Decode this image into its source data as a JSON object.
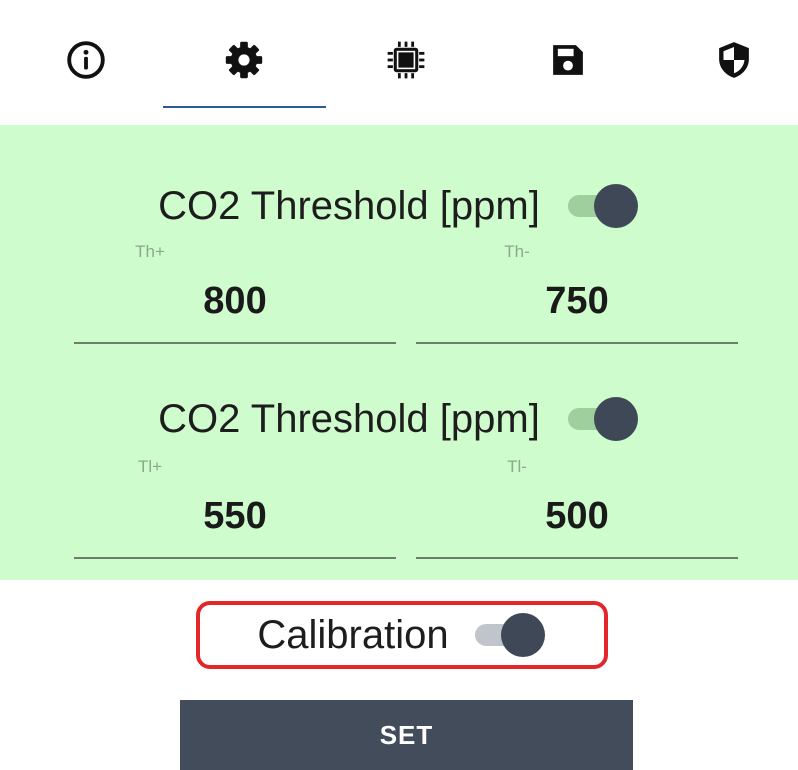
{
  "tabs": [
    {
      "icon": "info-icon",
      "selected": false
    },
    {
      "icon": "gear-icon",
      "selected": true
    },
    {
      "icon": "chip-icon",
      "selected": false
    },
    {
      "icon": "save-icon",
      "selected": false
    },
    {
      "icon": "shield-icon",
      "selected": false
    }
  ],
  "colors": {
    "panel_bg": "#cefccc",
    "switch_thumb": "#3f4857",
    "switch_track_panel": "#9fcf9d",
    "switch_track_white": "#c0c5cc",
    "underline_panel": "#6b7f6b",
    "tab_indicator": "#2f5a93",
    "calibration_border": "#e3262a",
    "button_bg": "#434c5a",
    "button_text": "#ffffff"
  },
  "threshold_high": {
    "title": "CO2 Threshold [ppm]",
    "enabled": true,
    "plus_label": "Th+",
    "plus_value": "800",
    "minus_label": "Th-",
    "minus_value": "750"
  },
  "threshold_low": {
    "title": "CO2 Threshold [ppm]",
    "enabled": true,
    "plus_label": "Tl+",
    "plus_value": "550",
    "minus_label": "Tl-",
    "minus_value": "500"
  },
  "calibration": {
    "label": "Calibration",
    "enabled": true
  },
  "set_button": {
    "label": "SET"
  }
}
